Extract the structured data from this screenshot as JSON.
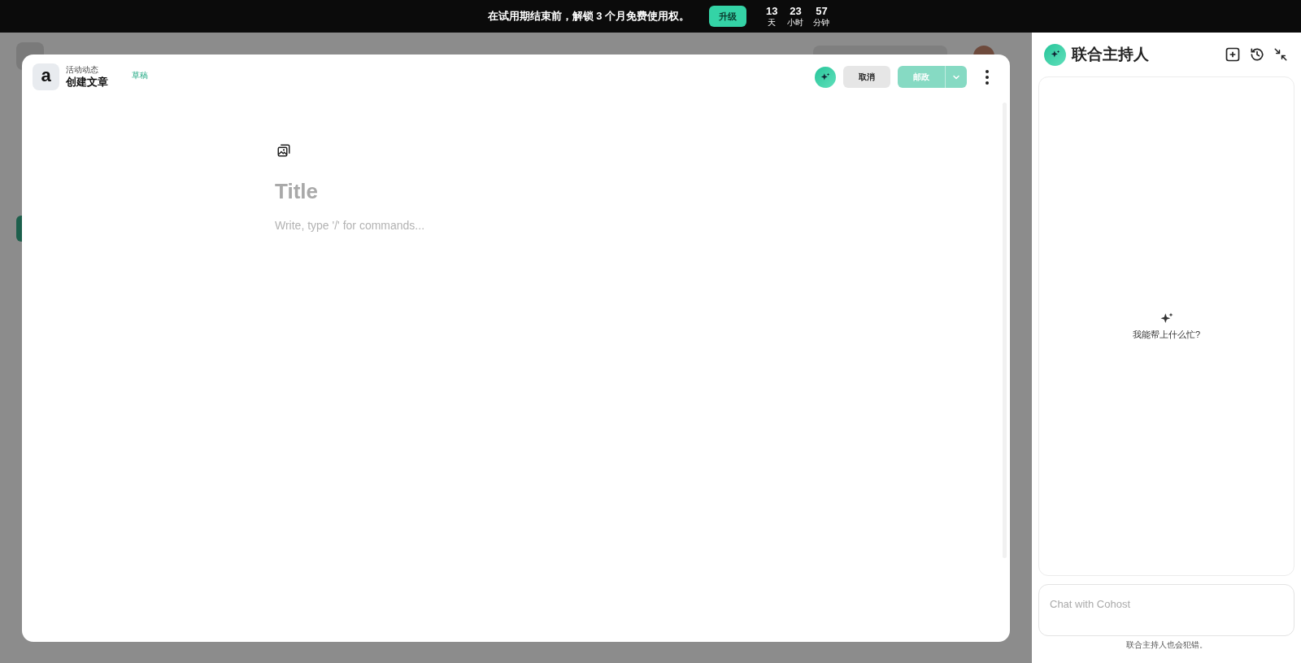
{
  "banner": {
    "message": "在试用期结束前，解锁 3 个月免费使用权。",
    "upgrade_button": "升级",
    "countdown": [
      {
        "value": "13",
        "unit": "天"
      },
      {
        "value": "23",
        "unit": "小时"
      },
      {
        "value": "57",
        "unit": "分钟"
      }
    ]
  },
  "editor": {
    "logo_letter": "a",
    "breadcrumb": "活动动态",
    "title": "创建文章",
    "status": "草稿",
    "cancel_button": "取消",
    "publish_button": "邮政",
    "publish_disabled": true,
    "title_placeholder": "Title",
    "body_placeholder": "Write, type '/' for commands..."
  },
  "cohost": {
    "title": "联合主持人",
    "empty_prompt": "我能帮上什么忙?",
    "chat_placeholder": "Chat with Cohost",
    "disclaimer": "联合主持人也会犯错。"
  }
}
